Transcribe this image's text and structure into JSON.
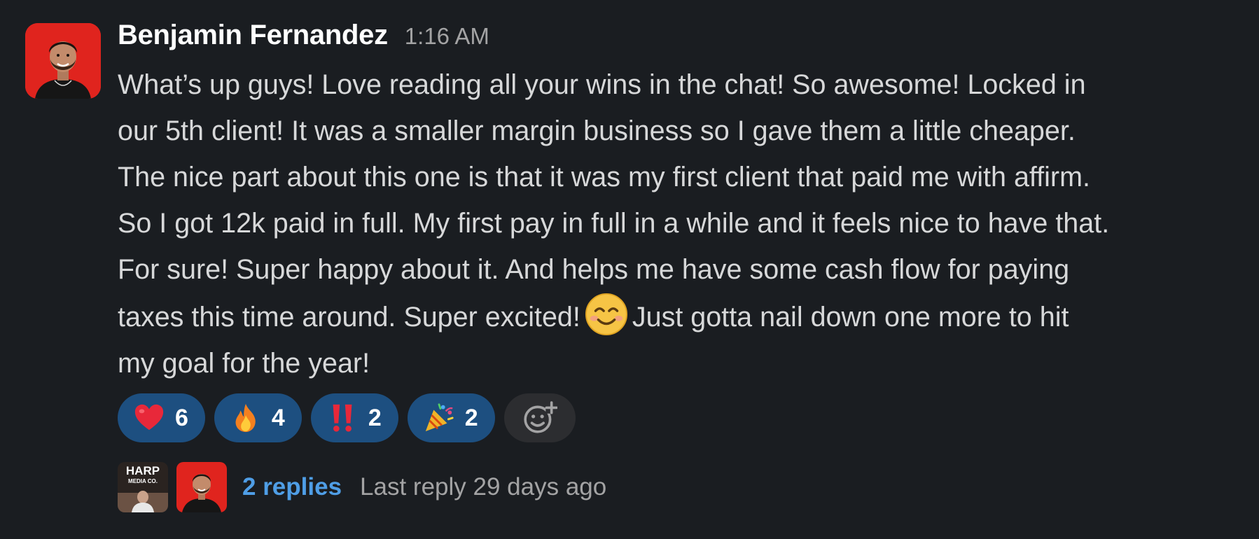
{
  "message": {
    "sender": "Benjamin Fernandez",
    "timestamp": "1:16 AM",
    "lines": [
      "What’s up guys! Love reading all your wins in the chat! So awesome! Locked in",
      "our 5th client! It was a smaller margin business so I gave them a little cheaper.",
      "The nice part about this one is that it was my first client that paid me with affirm.",
      "So I got 12k paid in full. My first pay in full in a while and it feels nice to have that.",
      "For sure! Super happy about it. And helps me have some cash flow for paying"
    ],
    "line6_before": "taxes this time around. Super excited!",
    "line6_emoji": "smiling-face-emoji",
    "line6_after": "Just gotta nail down one more to hit",
    "line7": "my goal for the year!"
  },
  "reactions": [
    {
      "icon": "heart-icon",
      "count": "6"
    },
    {
      "icon": "fire-icon",
      "count": "4"
    },
    {
      "icon": "double-exclamation-icon",
      "count": "2"
    },
    {
      "icon": "party-popper-icon",
      "count": "2"
    }
  ],
  "add_reaction_icon": "add-reaction-icon",
  "thread": {
    "avatar1_text_line1": "HARP",
    "avatar1_text_line2": "MEDIA CO.",
    "replies": "2 replies",
    "last_reply": "Last reply 29 days ago"
  },
  "colors": {
    "background": "#1a1d21",
    "reaction_bg": "#1d4f80",
    "link": "#4f9ee6",
    "avatar_bg": "#e0241e"
  }
}
